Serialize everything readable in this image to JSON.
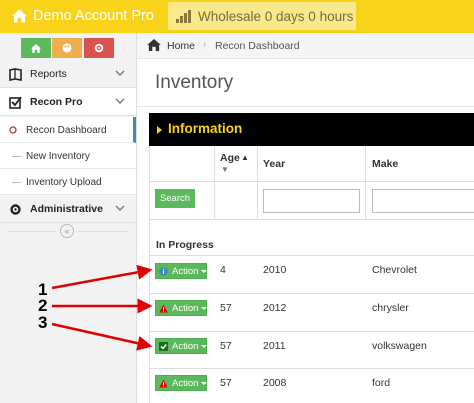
{
  "colors": {
    "brand_yellow": "#f9d21a",
    "wholesale_bg": "#fbe88a",
    "sidebar_btn_green": "#5cb85c",
    "sidebar_btn_yellow": "#f0ad4e",
    "sidebar_btn_red": "#d9534f",
    "accent_blue": "#3c8dbc",
    "annotation_red": "#e00000"
  },
  "app": {
    "title": "Demo Account Pro",
    "wholesale_status": "Wholesale 0 days 0 hours"
  },
  "sidebar": {
    "quick_buttons": [
      {
        "icon": "home-icon"
      },
      {
        "icon": "palette-icon"
      },
      {
        "icon": "gear-icon"
      }
    ],
    "items": [
      {
        "label": "Reports",
        "icon": "book-icon"
      },
      {
        "label": "Recon Pro",
        "icon": "checkbox-icon"
      },
      {
        "label": "Administrative",
        "icon": "gear-icon"
      }
    ],
    "recon_subitems": [
      {
        "label": "Recon Dashboard",
        "active": true
      },
      {
        "label": "New Inventory"
      },
      {
        "label": "Inventory Upload"
      }
    ]
  },
  "breadcrumb": {
    "home": "Home",
    "current": "Recon Dashboard"
  },
  "page": {
    "title": "Inventory"
  },
  "info_bar": {
    "label": "Information"
  },
  "table": {
    "columns": {
      "age": "Age",
      "year": "Year",
      "make": "Make"
    },
    "search_label": "Search",
    "section_label": "In Progress",
    "rows": [
      {
        "action": "Action",
        "status_icon": "info-icon",
        "age": "4",
        "year": "2010",
        "make": "Chevrolet"
      },
      {
        "action": "Action",
        "status_icon": "warning-icon",
        "age": "57",
        "year": "2012",
        "make": "chrysler"
      },
      {
        "action": "Action",
        "status_icon": "check-icon",
        "age": "57",
        "year": "2011",
        "make": "volkswagen"
      },
      {
        "action": "Action",
        "status_icon": "warning-icon",
        "age": "57",
        "year": "2008",
        "make": "ford"
      }
    ]
  },
  "annotations": [
    "1",
    "2",
    "3"
  ]
}
